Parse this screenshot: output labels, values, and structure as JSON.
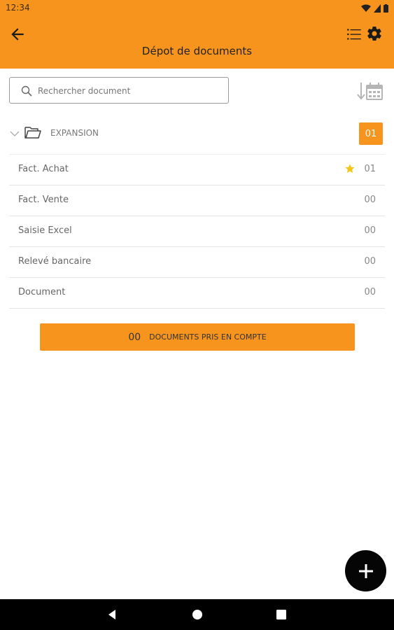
{
  "status_bar": {
    "time": "12:34"
  },
  "app_bar": {
    "title": "Dépot de documents"
  },
  "search": {
    "placeholder": "Rechercher document",
    "value": ""
  },
  "folder": {
    "name": "EXPANSION",
    "count": "01"
  },
  "documents": [
    {
      "label": "Fact. Achat",
      "count": "01",
      "starred": true
    },
    {
      "label": "Fact. Vente",
      "count": "00",
      "starred": false
    },
    {
      "label": "Saisie Excel",
      "count": "00",
      "starred": false
    },
    {
      "label": "Relevé bancaire",
      "count": "00",
      "starred": false
    },
    {
      "label": "Document",
      "count": "00",
      "starred": false
    }
  ],
  "summary": {
    "count": "00",
    "label": "DOCUMENTS PRIS EN COMPTE"
  },
  "icons": {
    "back": "arrow-back-icon",
    "list": "list-icon",
    "settings": "gear-icon",
    "search": "search-icon",
    "sort": "sort-by-date-icon",
    "folder": "folder-open-icon",
    "star": "star-icon",
    "add": "plus-icon"
  },
  "colors": {
    "accent": "#f7941d",
    "star": "#f5c518",
    "fab": "#050505"
  }
}
